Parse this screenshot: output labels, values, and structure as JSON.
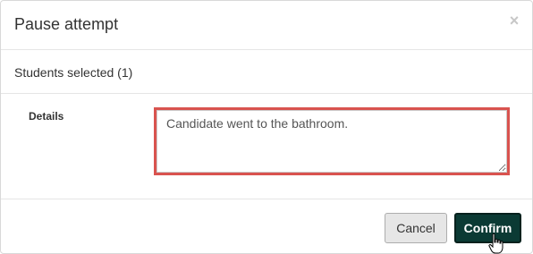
{
  "modal": {
    "title": "Pause attempt",
    "close_label": "×"
  },
  "selection": {
    "text": "Students selected (1)"
  },
  "form": {
    "details_label": "Details",
    "details_value": "Candidate went to the bathroom."
  },
  "footer": {
    "cancel_label": "Cancel",
    "confirm_label": "Confirm"
  },
  "colors": {
    "confirm_bg": "#0b3a34",
    "highlight_border": "#d9534f"
  },
  "icons": {
    "close": "close-icon",
    "cursor": "hand-pointer-icon",
    "resize": "resize-grip-icon"
  }
}
